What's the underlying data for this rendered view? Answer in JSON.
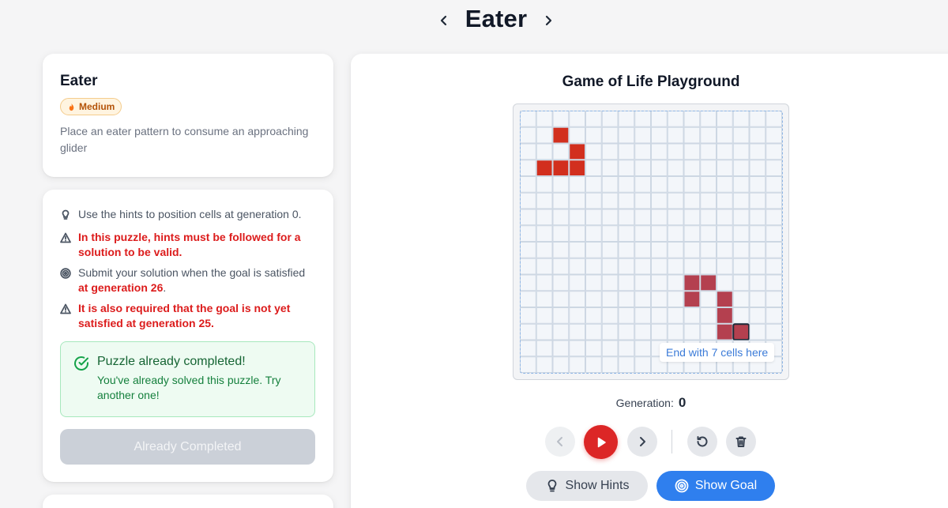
{
  "nav": {
    "title": "Eater"
  },
  "info": {
    "title": "Eater",
    "difficulty": "Medium",
    "description": "Place an eater pattern to consume an approaching glider"
  },
  "hints": {
    "line1": "Use the hints to position cells at generation 0.",
    "line2": "In this puzzle, hints must be followed for a solution to be valid.",
    "line3_plain": "Submit your solution when the goal is satisfied",
    "line3_red": "at generation 26",
    "line3_end": ".",
    "line4": "It is also required that the goal is not yet satisfied at generation 25."
  },
  "completion": {
    "title": "Puzzle already completed!",
    "body": "You've already solved this puzzle. Try another one!",
    "button": "Already Completed"
  },
  "playground": {
    "title": "Game of Life Playground",
    "goal_label": "End with 7 cells here",
    "generation_label": "Generation:",
    "generation_value": "0",
    "show_hints": "Show Hints",
    "show_goal": "Show Goal"
  },
  "board": {
    "rows": 16,
    "cols": 16,
    "glider_cells": [
      [
        1,
        2
      ],
      [
        2,
        3
      ],
      [
        3,
        1
      ],
      [
        3,
        2
      ],
      [
        3,
        3
      ]
    ],
    "eater_cells": [
      [
        10,
        10
      ],
      [
        10,
        11
      ],
      [
        11,
        10
      ],
      [
        11,
        12
      ],
      [
        12,
        12
      ],
      [
        13,
        12
      ],
      [
        13,
        13
      ]
    ],
    "highlighted_cell": [
      13,
      13
    ],
    "colors": {
      "glider": "#d22f1e",
      "eater": "#b4404f",
      "cell_empty": "#f3f6fa",
      "grid_line": "#cdd7e3"
    }
  }
}
